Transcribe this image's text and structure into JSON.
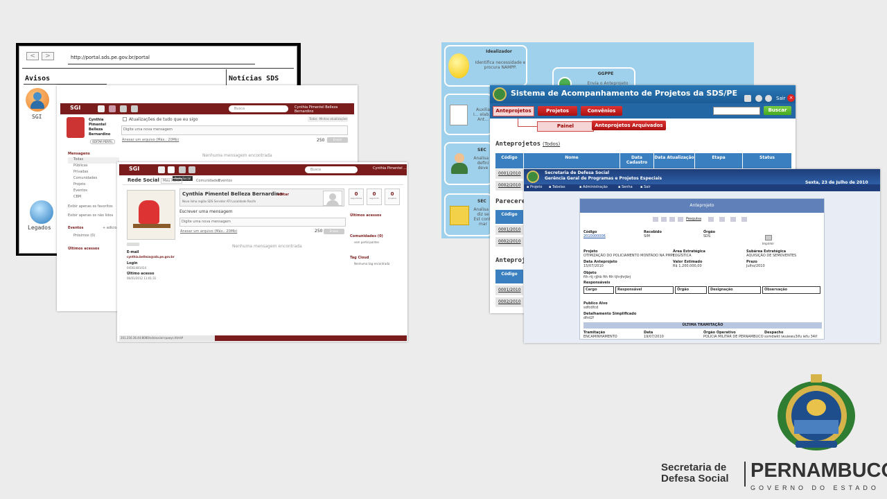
{
  "portal": {
    "url": "http://portal.sds.pe.gov.br/portal",
    "avisos": "Avisos",
    "noticias": "Notícias SDS",
    "sgi_label": "SGI",
    "legados_label": "Legados"
  },
  "sgi_back": {
    "logo": "SGI",
    "search_placeholder": "Busca",
    "user": "Cynthia Pimentel Belleza Bernardino",
    "profile_name": "Cynthia Pimentel Belleza Bernardino",
    "edit_profile": "EDITAR PERFIL",
    "updates_title": "Atualizações de tudo que eu sigo",
    "tab_todos": "Todos",
    "tab_minhas": "Minhas atualizações",
    "write_placeholder": "Digite uma nova mensagem",
    "attach": "Anexar um arquivo (Máx.: 20Mb)",
    "count": "250",
    "send": "Enviar",
    "empty": "Nenhuma mensagem encontrada",
    "sidebar_header": "Mensagens",
    "sidebar_items": [
      "Todas",
      "Públicas",
      "Privadas",
      "Comunidades",
      "Projeto",
      "Eventos",
      "CBM"
    ],
    "check1": "Exibir apenas os favoritos",
    "check2": "Exibir apenas os não lidos",
    "eventos": "Eventos",
    "adicionar": "+ adicionar",
    "proximos": "Próximos (0)",
    "ultimos": "Últimos acessos"
  },
  "sgi_front": {
    "logo": "SGI",
    "search_placeholder": "Busca",
    "user": "Cynthia Pimentel ...",
    "tooltip": "Rede Social",
    "page_title": "Rede Social",
    "crumbs": [
      "Meu Perfil",
      "Comunidades",
      "Eventos"
    ],
    "profile_name": "Cynthia Pimentel Belleza Bernardino",
    "editar": "editar",
    "profile_meta": "Nova linha região SDS  Servidor ATI  Localidade Recife",
    "stats": [
      {
        "n": "0",
        "label": "seguidores"
      },
      {
        "n": "0",
        "label": "seguindo"
      },
      {
        "n": "0",
        "label": "projetos"
      }
    ],
    "write_title": "Escrever uma mensagem",
    "write_placeholder": "Digite uma nova mensagem",
    "attach": "Anexar um arquivo (Máx.: 20Mb)",
    "count": "250",
    "send": "Enviar",
    "empty": "Nenhuma mensagem encontrada",
    "email_label": "E-mail",
    "email": "cynthia.belleza@sds.pe.gov.br",
    "login_label": "Login",
    "login": "04561481414",
    "last_label": "Último acesso",
    "last": "06/01/2012 11:01:31",
    "ultimos_acessos": "Últimos acessos",
    "comunidades": "Comunidades (0)",
    "comunidades_sub": "sem participantes",
    "tag_cloud": "Tag Cloud",
    "tag_sub": "Nenhuma tag encontrada",
    "status_url": "201.216.36.44:8080/sds/social-rpaeys.html#"
  },
  "flow": {
    "idealizador_title": "Idealizador",
    "idealizador_text": "Identifica necessidade e procura NAMPP.",
    "ggppe_title": "GGPPE",
    "ggppe_text": "Envia o Anteprojeto",
    "left2_text": "Auxilia I... elab... Ant...",
    "left3_title": "SEC",
    "left3_text": "Analisa a defini deve",
    "left4_title": "SEC",
    "left4_text": "Analisa e diz se Est contr mar"
  },
  "sds": {
    "title": "Sistema de Acompanhamento de Projetos da SDS/PE",
    "sair": "Sair",
    "tabs": [
      "Anteprojetos",
      "Projetos",
      "Convênios"
    ],
    "buscar": "Buscar",
    "sub_painel": "Painel",
    "sub_arquivados": "Anteprojetos Arquivados",
    "section1": "Anteprojetos",
    "todos": "(Todos)",
    "columns": [
      "Código",
      "Nome",
      "Data Cadastro",
      "Data Atualização",
      "Etapa",
      "Status"
    ],
    "rows1": [
      "0001/2010",
      "0002/2010"
    ],
    "section2": "Parecere",
    "rows2": [
      "0001/2010",
      "0002/2010"
    ],
    "section3": "Anteproje",
    "rows3": [
      "0001/2010",
      "0002/2010"
    ]
  },
  "ante": {
    "org1": "Secretaria de Defesa Social",
    "org2": "Gerência Geral de Programas e Projetos Especiais",
    "date": "Sexta, 23 de Julho de 2010",
    "menu": [
      "Projeto",
      "Tabelas",
      "Administração",
      "Senha",
      "Sair"
    ],
    "card_title": "Anteprojeto",
    "pesquisa": "Pesquisa",
    "codigo_l": "Código",
    "codigo": "2010000006",
    "recebido_l": "Recebido",
    "recebido": "SIM",
    "orgao_l": "Órgão",
    "orgao": "SDS",
    "imprimir": "Imprimir",
    "projeto_l": "Projeto",
    "projeto": "OTIMIZAÇÃO DO POLICIAMENTO MONTADO NA PMPE",
    "area_l": "Área Estratégica",
    "area": "LOGÍSTICA",
    "subarea_l": "Subárea Estratégica",
    "subarea": "AQUISIÇÃO DE SEMOVENTES",
    "data_l": "Data Anteprojeto",
    "data": "15/07/2010",
    "valor_l": "Valor Estimado",
    "valor": "R$ 1.200.000,00",
    "prazo_l": "Prazo",
    "prazo": "Julho/2010",
    "objeto_l": "Objeto",
    "objeto": "fth rtj rjjhb fth fth tjhrjhrjbrj",
    "resp_l": "Responsáveis",
    "resp_cols": [
      "Cargo",
      "Responsável",
      "Órgão",
      "Designação",
      "Observação"
    ],
    "publico_l": "Publico Alvo",
    "publico": "sdfcdfcd",
    "detalhe_l": "Detalhamento Simplificado",
    "detalhe": "dfrd2f",
    "ultima": "ÚLTIMA TRAMITAÇÃO",
    "tram_cols": [
      "Tramitação",
      "Data",
      "Órgão Operativo",
      "Despacho"
    ],
    "tram_vals": [
      "ENCAMINHAMENTO",
      "19/07/2010",
      "POLICIA MILITAR DE PERNAMBUCO",
      "sxmdwkt iwuiewu3ifu iefu 34if"
    ]
  },
  "brand": {
    "sec1": "Secretaria de",
    "sec2": "Defesa Social",
    "pe": "PERNAMBUCO",
    "gov": "GOVERNO DO ESTADO"
  },
  "colors": {
    "sgi_bar": "#7b1c1c",
    "sds_blue": "#2467a5",
    "flow_bg": "#9fd1ec",
    "ante_blue": "#1d3e7a"
  }
}
